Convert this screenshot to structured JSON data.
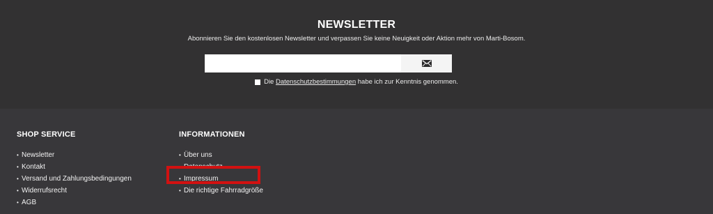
{
  "newsletter": {
    "title": "NEWSLETTER",
    "description": "Abonnieren Sie den kostenlosen Newsletter und verpassen Sie keine Neuigkeit oder Aktion mehr von Marti-Bosom.",
    "email_placeholder": "",
    "submit_icon": "envelope-icon",
    "consent": {
      "prefix": "Die ",
      "link_label": "Datenschutzbestimmungen",
      "suffix": " habe ich zur Kenntnis genommen."
    }
  },
  "footer": {
    "shop_service": {
      "title": "SHOP SERVICE",
      "items": [
        "Newsletter",
        "Kontakt",
        "Versand und Zahlungsbedingungen",
        "Widerrufsrecht",
        "AGB"
      ]
    },
    "informationen": {
      "title": "INFORMATIONEN",
      "items": [
        "Über uns",
        "Datenschutz",
        "Impressum",
        "Die richtige Fahrradgröße"
      ]
    }
  },
  "colors": {
    "newsletter_bg": "#323132",
    "footer_bg": "#38373a",
    "highlight": "#d21111"
  }
}
